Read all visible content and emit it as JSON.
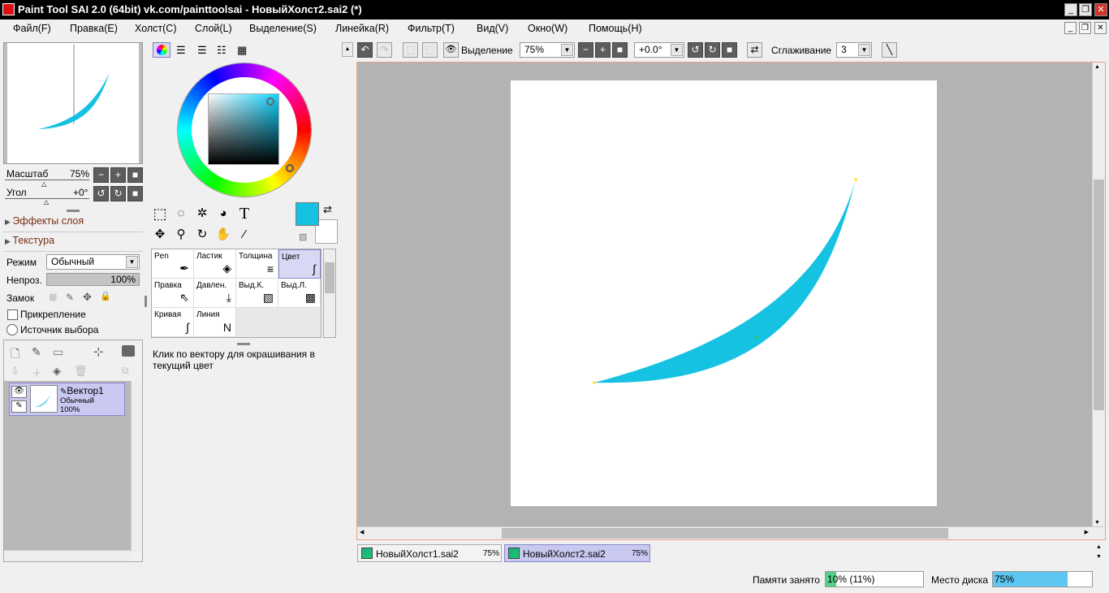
{
  "window": {
    "title": "Paint Tool SAI 2.0 (64bit) vk.com/painttoolsai - НовыйХолст2.sai2 (*)"
  },
  "menu": [
    "Файл(F)",
    "Правка(E)",
    "Холст(C)",
    "Слой(L)",
    "Выделение(S)",
    "Линейка(R)",
    "Фильтр(T)",
    "Вид(V)",
    "Окно(W)",
    "Помощь(H)"
  ],
  "navigator": {
    "zoom_label": "Масштаб",
    "zoom_value": "75%",
    "angle_label": "Угол",
    "angle_value": "+0°"
  },
  "layer_panel": {
    "effects_label": "Эффекты слоя",
    "texture_label": "Текстура",
    "mode_label": "Режим",
    "mode_value": "Обычный",
    "opacity_label": "Непроз.",
    "opacity_value": "100%",
    "lock_label": "Замок",
    "clip_label": "Прикрепление",
    "source_label": "Источник выбора",
    "layers": [
      {
        "name": "Вектор1",
        "mode": "Обычный",
        "opacity": "100%"
      }
    ]
  },
  "tool_panel": {
    "tools": [
      "Pen",
      "Ластик",
      "Толщина",
      "Цвет",
      "Правка",
      "Давлен.",
      "Выд.К.",
      "Выд.Л.",
      "Кривая",
      "Линия"
    ],
    "active_tool": "Цвет",
    "hint": "Клик по вектору для окрашивания в текущий цвет",
    "fg_color": "#16c2e2"
  },
  "toolbar": {
    "selection_label": "Выделение",
    "zoom_value": "75%",
    "angle_value": "+0.0°",
    "stabilizer_label": "Сглаживание",
    "stabilizer_value": "3"
  },
  "tabs": [
    {
      "name": "НовыйХолст1.sai2",
      "zoom": "75%",
      "active": false
    },
    {
      "name": "НовыйХолст2.sai2",
      "zoom": "75%",
      "active": true
    }
  ],
  "status": {
    "memory_label": "Памяти занято",
    "memory_value": "10% (11%)",
    "memory_fraction": 0.11,
    "disk_label": "Место диска",
    "disk_value": "75%",
    "disk_fraction": 0.75
  },
  "colors": {
    "accent": "#16c2e2",
    "tab_active": "#c8c8f0",
    "canvas_border": "#e6a57f"
  }
}
